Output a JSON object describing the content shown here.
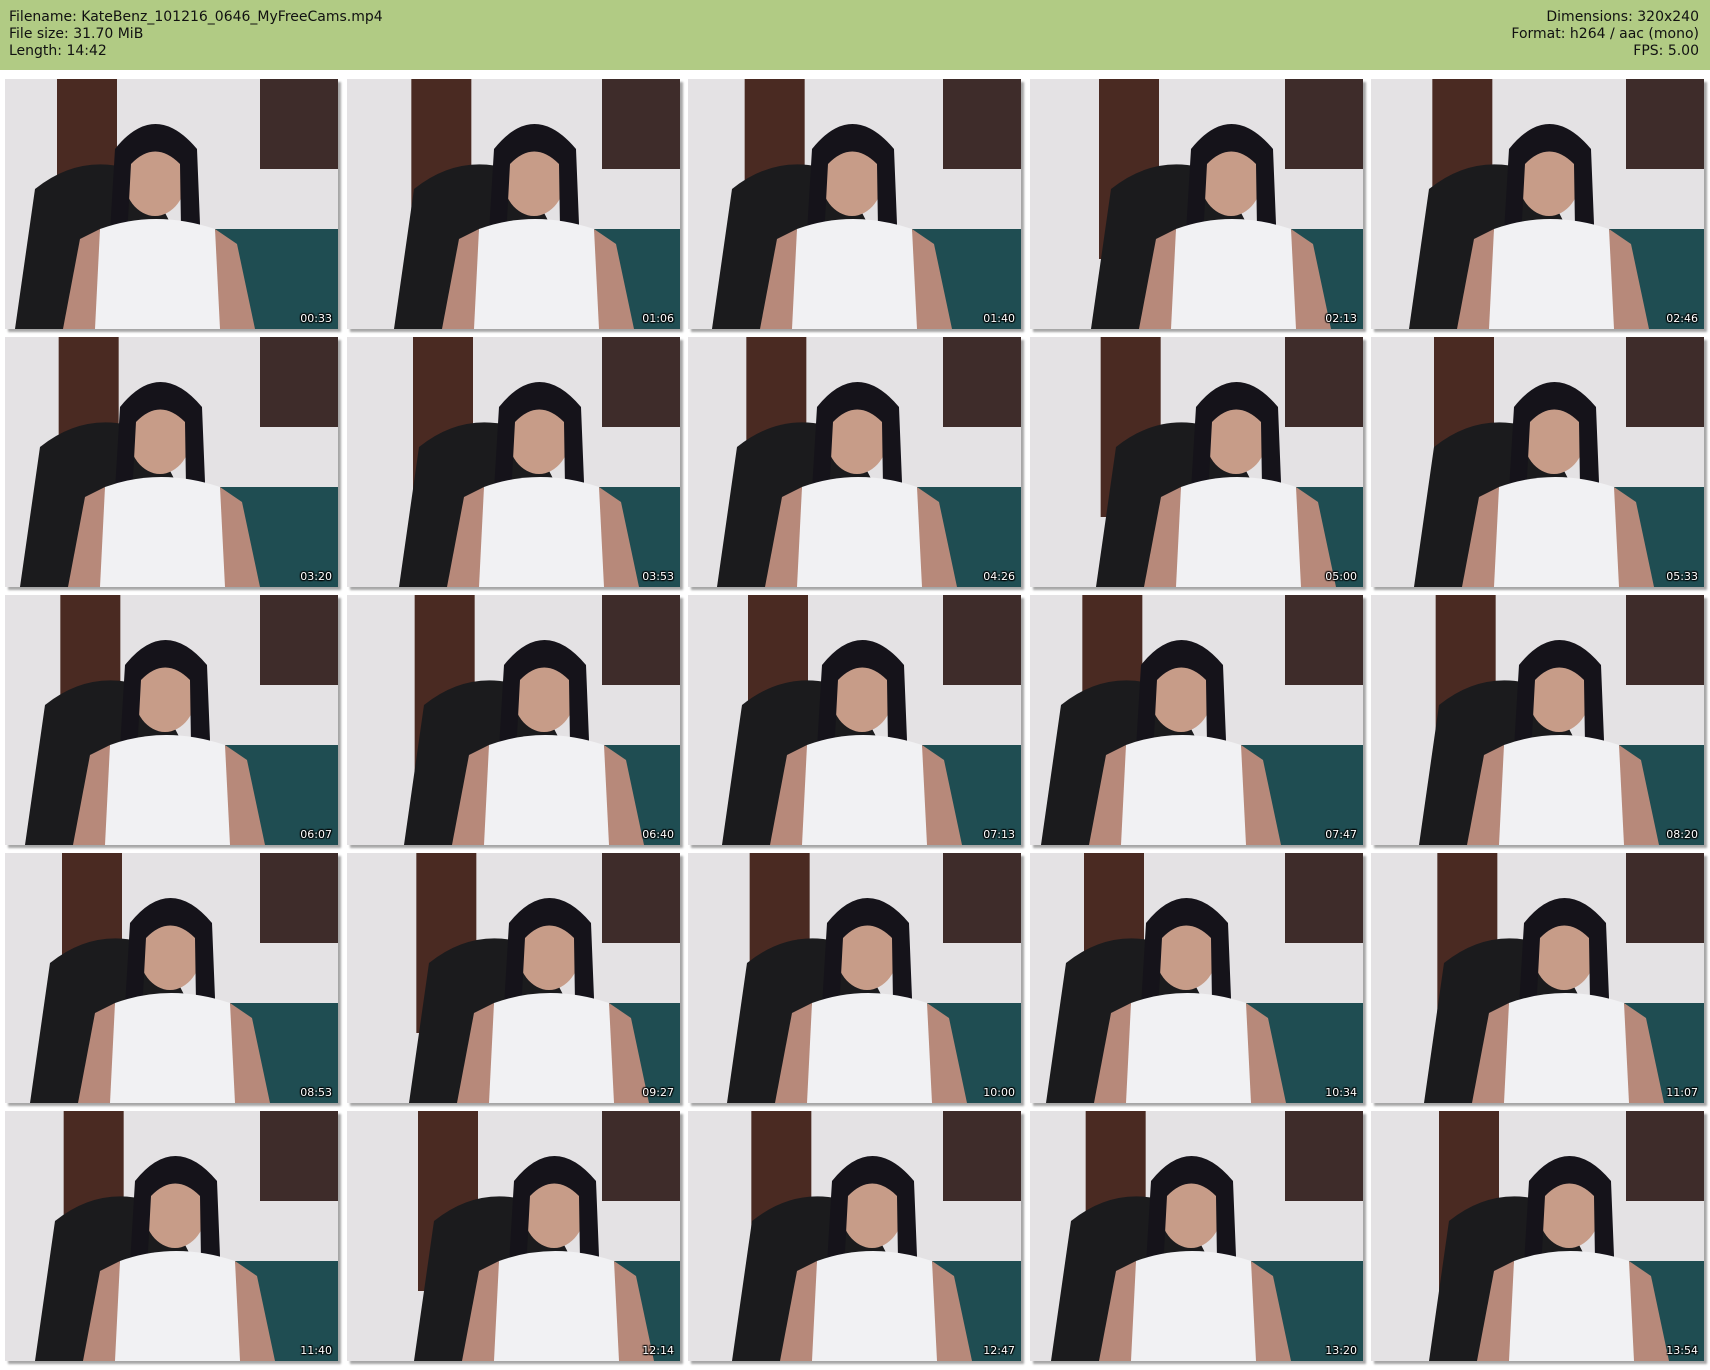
{
  "header": {
    "filename": "Filename: KateBenz_101216_0646_MyFreeCams.mp4",
    "file_size": "File size: 31.70 MiB",
    "length": "Length: 14:42",
    "dimensions": "Dimensions: 320x240",
    "format": "Format: h264 / aac (mono)",
    "fps": "FPS: 5.00"
  },
  "thumbnails": [
    {
      "time": "00:33"
    },
    {
      "time": "01:06"
    },
    {
      "time": "01:40"
    },
    {
      "time": "02:13"
    },
    {
      "time": "02:46"
    },
    {
      "time": "03:20"
    },
    {
      "time": "03:53"
    },
    {
      "time": "04:26"
    },
    {
      "time": "05:00"
    },
    {
      "time": "05:33"
    },
    {
      "time": "06:07"
    },
    {
      "time": "06:40"
    },
    {
      "time": "07:13"
    },
    {
      "time": "07:47"
    },
    {
      "time": "08:20"
    },
    {
      "time": "08:53"
    },
    {
      "time": "09:27"
    },
    {
      "time": "10:00"
    },
    {
      "time": "10:34"
    },
    {
      "time": "11:07"
    },
    {
      "time": "11:40"
    },
    {
      "time": "12:14"
    },
    {
      "time": "12:47"
    },
    {
      "time": "13:20"
    },
    {
      "time": "13:54"
    }
  ],
  "colors": {
    "header_bg": "#b1cb84",
    "page_bg": "#ffffff",
    "timestamp_text": "#ffffff"
  }
}
